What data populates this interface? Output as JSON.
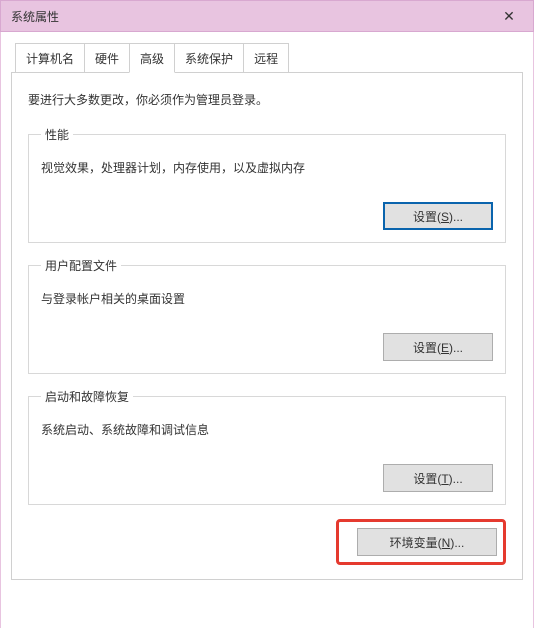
{
  "window": {
    "title": "系统属性",
    "close_glyph": "✕"
  },
  "tabs": {
    "computer_name": "计算机名",
    "hardware": "硬件",
    "advanced": "高级",
    "system_protection": "系统保护",
    "remote": "远程"
  },
  "advanced_panel": {
    "intro": "要进行大多数更改，你必须作为管理员登录。",
    "performance": {
      "legend": "性能",
      "desc": "视觉效果，处理器计划，内存使用，以及虚拟内存",
      "button_prefix": "设置(",
      "button_key": "S",
      "button_suffix": ")..."
    },
    "user_profiles": {
      "legend": "用户配置文件",
      "desc": "与登录帐户相关的桌面设置",
      "button_prefix": "设置(",
      "button_key": "E",
      "button_suffix": ")..."
    },
    "startup_recovery": {
      "legend": "启动和故障恢复",
      "desc": "系统启动、系统故障和调试信息",
      "button_prefix": "设置(",
      "button_key": "T",
      "button_suffix": ")..."
    },
    "env_vars": {
      "button_prefix": "环境变量(",
      "button_key": "N",
      "button_suffix": ")..."
    }
  }
}
